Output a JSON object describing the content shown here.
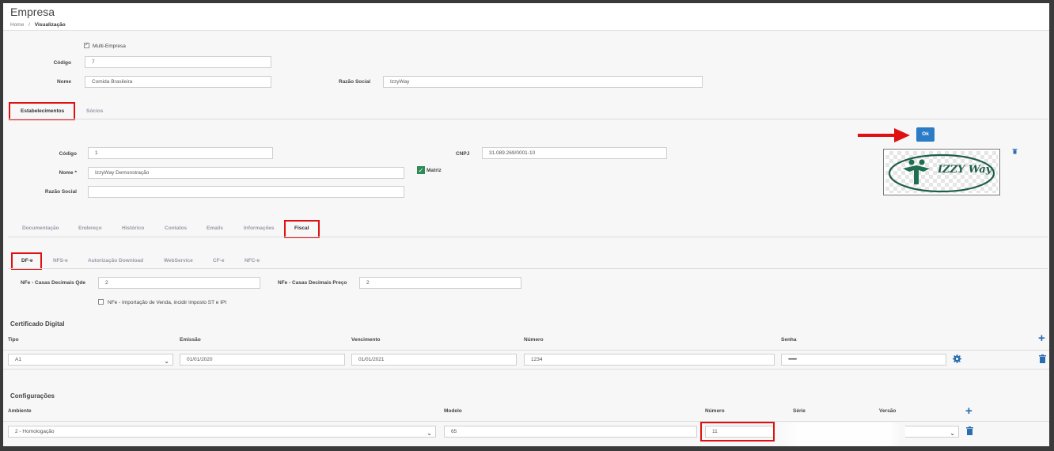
{
  "header": {
    "title": "Empresa",
    "breadcrumb_home": "Home",
    "breadcrumb_sep": "/",
    "breadcrumb_current": "Visualização"
  },
  "empresa": {
    "multi_empresa_label": "Multi-Empresa",
    "multi_empresa_checked": true,
    "codigo_label": "Código",
    "codigo_value": "7",
    "nome_label": "Nome",
    "nome_value": "Comida Brasileira",
    "razao_label": "Razão Social",
    "razao_value": "IzzyWay"
  },
  "main_tabs": [
    {
      "label": "Estabelecimentos",
      "active": true
    },
    {
      "label": "Sócios",
      "active": false
    }
  ],
  "estabelecimento": {
    "codigo_label": "Código",
    "codigo_value": "1",
    "nome_label": "Nome *",
    "nome_value": "IzzyWay Demonstração",
    "razao_label": "Razão Social",
    "razao_value": "",
    "cnpj_label": "CNPJ",
    "cnpj_value": "31.089.269/0001-10",
    "matriz_label": "Matriz",
    "matriz_checked": true,
    "ok_label": "Ok",
    "logo_text": "IZZY Way"
  },
  "sub_tabs": [
    {
      "label": "Documentação",
      "active": false
    },
    {
      "label": "Endereço",
      "active": false
    },
    {
      "label": "Histórico",
      "active": false
    },
    {
      "label": "Contatos",
      "active": false
    },
    {
      "label": "Emails",
      "active": false
    },
    {
      "label": "Informações",
      "active": false
    },
    {
      "label": "Fiscal",
      "active": true
    }
  ],
  "fiscal_tabs": [
    {
      "label": "DF-e",
      "active": true
    },
    {
      "label": "NFS-e",
      "active": false
    },
    {
      "label": "Autorização Download",
      "active": false
    },
    {
      "label": "WebService",
      "active": false
    },
    {
      "label": "CF-e",
      "active": false
    },
    {
      "label": "NFC-e",
      "active": false
    }
  ],
  "dfe": {
    "casas_qtde_label": "NFe - Casas Decimais Qde",
    "casas_qtde_value": "2",
    "casas_preco_label": "NFe - Casas Decimais Preço",
    "casas_preco_value": "2",
    "importacao_label": "NFe - Importação de Venda, incidir imposto ST e IPI",
    "importacao_checked": false
  },
  "certificado": {
    "title": "Certificado Digital",
    "columns": [
      "Tipo",
      "Emissão",
      "Vencimento",
      "Número",
      "Senha"
    ],
    "row": {
      "tipo": "A1",
      "emissao": "01/01/2020",
      "vencimento": "01/01/2021",
      "numero": "1234",
      "senha": "••••••••"
    }
  },
  "configuracoes": {
    "title": "Configurações",
    "columns": [
      "Ambiente",
      "Modelo",
      "Número",
      "Série",
      "Versão"
    ],
    "row": {
      "ambiente": "2 - Homologação",
      "modelo": "65",
      "numero": "11"
    }
  },
  "colors": {
    "highlight": "#e01010",
    "accent": "#2a7cc7",
    "check_green": "#2e8b57"
  }
}
